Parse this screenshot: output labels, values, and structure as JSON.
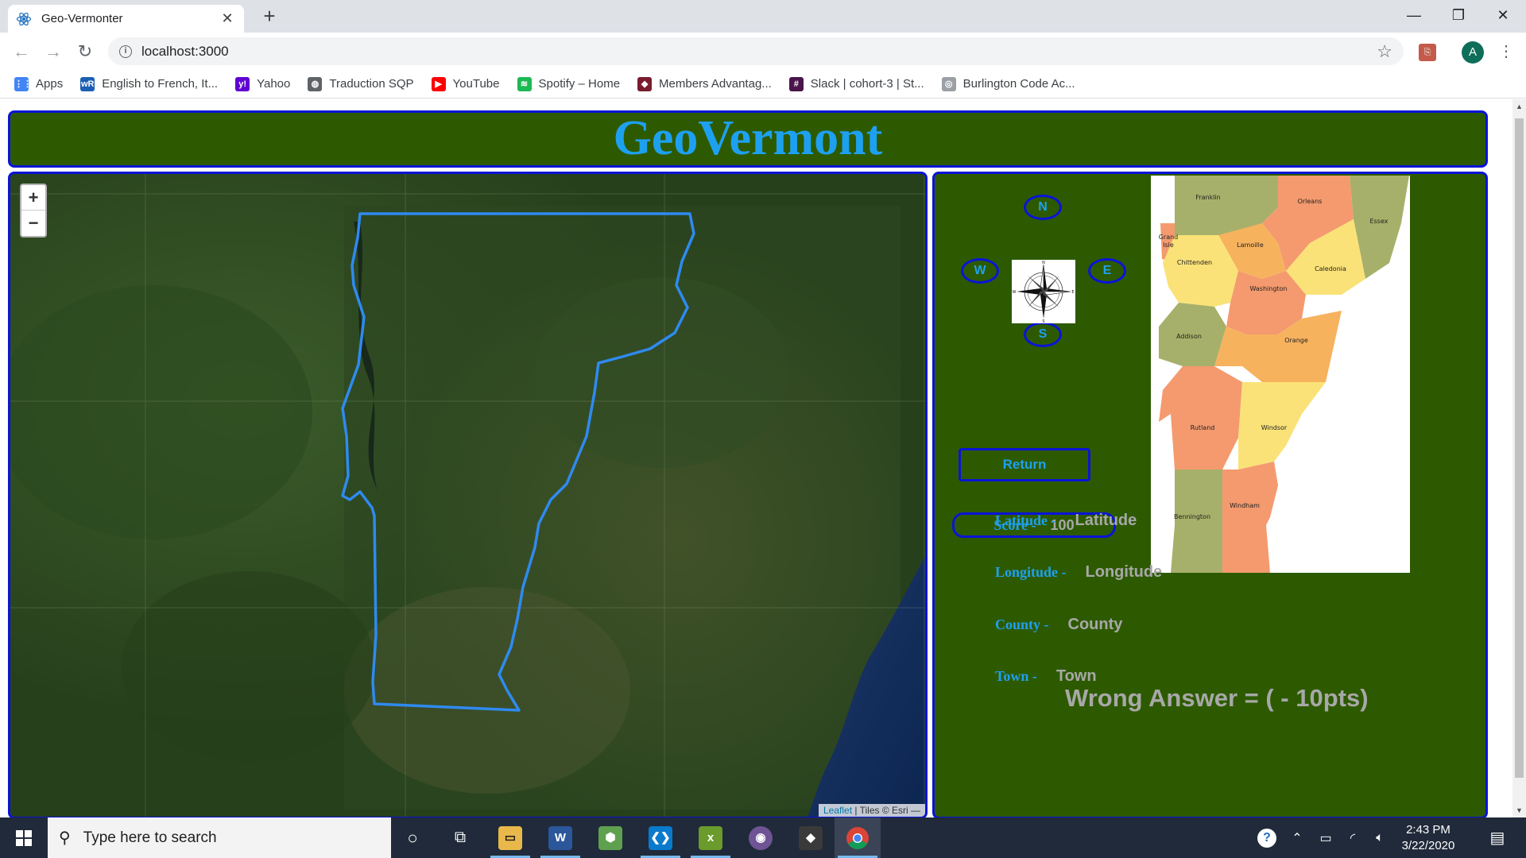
{
  "browser": {
    "tab_title": "Geo-Vermonter",
    "tab_close": "✕",
    "new_tab": "+",
    "url": "localhost:3000",
    "avatar_letter": "A",
    "window_controls": {
      "minimize": "—",
      "restore": "❐",
      "close": "✕"
    }
  },
  "bookmarks": [
    {
      "label": "Apps",
      "icon": "apps-grid-icon",
      "color": "#4285f4",
      "glyph": "⋮⋮"
    },
    {
      "label": "English to French, It...",
      "icon": "wordreference-icon",
      "color": "#1a5fb4",
      "glyph": "wR"
    },
    {
      "label": "Yahoo",
      "icon": "yahoo-icon",
      "color": "#6001d2",
      "glyph": "y!"
    },
    {
      "label": "Traduction SQP",
      "icon": "globe-icon",
      "color": "#5f6368",
      "glyph": "◍"
    },
    {
      "label": "YouTube",
      "icon": "youtube-icon",
      "color": "#ff0000",
      "glyph": "▶"
    },
    {
      "label": "Spotify – Home",
      "icon": "spotify-icon",
      "color": "#1db954",
      "glyph": "≋"
    },
    {
      "label": "Members Advantag...",
      "icon": "members-icon",
      "color": "#7a1c2e",
      "glyph": "◆"
    },
    {
      "label": "Slack | cohort-3 | St...",
      "icon": "slack-icon",
      "color": "#4a154b",
      "glyph": "#"
    },
    {
      "label": "Burlington Code Ac...",
      "icon": "burlington-icon",
      "color": "#9aa0a6",
      "glyph": "◎"
    }
  ],
  "page": {
    "title": "GeoVermont",
    "map": {
      "zoom_in": "+",
      "zoom_out": "−",
      "attribution_link": "Leaflet",
      "attribution_text": " | Tiles © Esri —"
    },
    "directions": {
      "north": "N",
      "south": "S",
      "east": "E",
      "west": "W"
    },
    "return_label": "Return",
    "score_label": "Score -",
    "score_value": "100",
    "info": [
      {
        "label": "Latitude -",
        "value": "Latitude"
      },
      {
        "label": "Longitude -",
        "value": "Longitude"
      },
      {
        "label": "County -",
        "value": "County"
      },
      {
        "label": "Town -",
        "value": "Town"
      }
    ],
    "penalty_text": "Wrong Answer = ( - 10pts)",
    "county_map_labels": [
      "Franklin",
      "Orleans",
      "Essex",
      "Grand Isle",
      "Lamoille",
      "Chittenden",
      "Caledonia",
      "Washington",
      "Addison",
      "Orange",
      "Rutland",
      "Windsor",
      "Bennington",
      "Windham"
    ]
  },
  "taskbar": {
    "search_placeholder": "Type here to search",
    "time": "2:43 PM",
    "date": "3/22/2020"
  },
  "colors": {
    "panel_green": "#2d5a00",
    "border_blue": "#0a14d8",
    "accent_blue": "#1ea0f0",
    "muted_gray": "#a8a8a8"
  }
}
